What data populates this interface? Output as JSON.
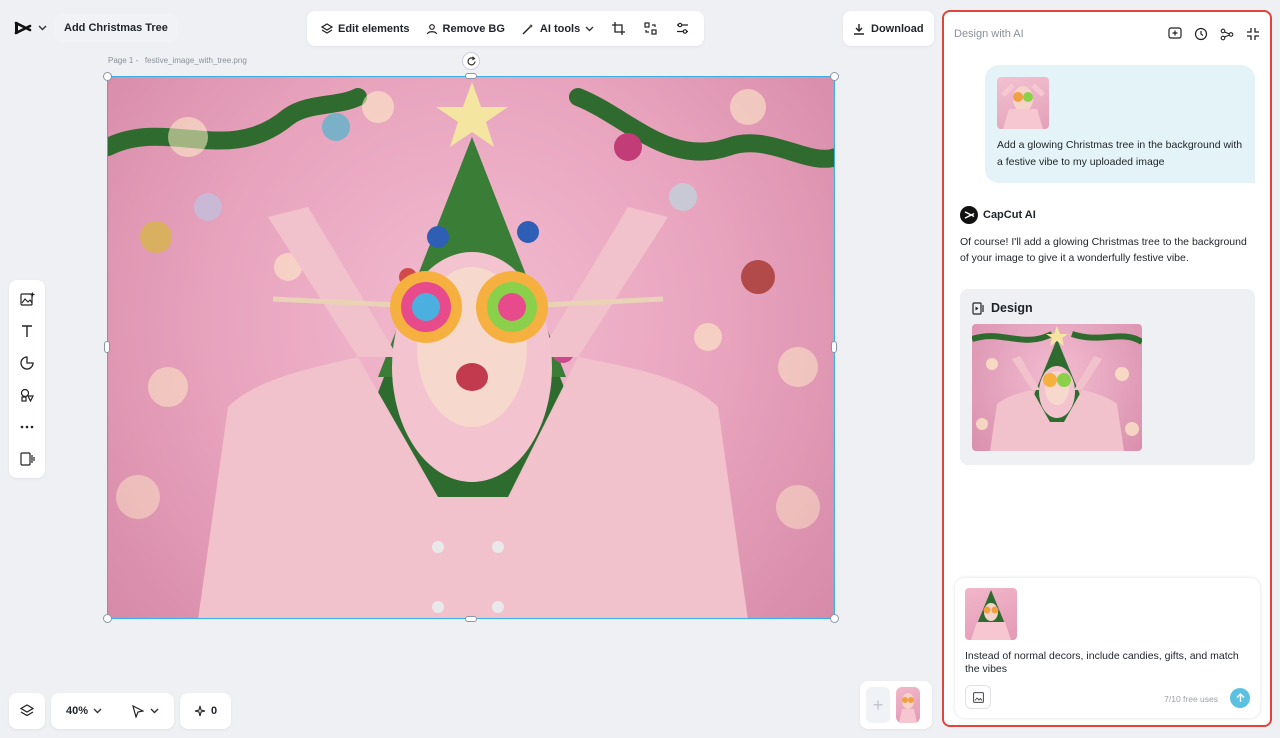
{
  "header": {
    "title": "Add Christmas Tree",
    "download_label": "Download"
  },
  "toolbar": {
    "edit_elements": "Edit elements",
    "remove_bg": "Remove BG",
    "ai_tools": "AI tools"
  },
  "canvas": {
    "page_label": "Page 1 -",
    "file_name": "festive_image_with_tree.png"
  },
  "bottom_bar": {
    "zoom": "40%",
    "credits": "0"
  },
  "ai_panel": {
    "title": "Design with AI",
    "user_message": "Add a glowing Christmas tree in the background with a festive vibe to my uploaded image",
    "ai_name": "CapCut AI",
    "ai_reply": "Of course! I'll add a glowing Christmas tree to the background of your image to give it a wonderfully festive vibe.",
    "design_label": "Design",
    "input_text": "Instead of normal decors, include candies, gifts, and match the vibes",
    "free_uses": "7/10 free uses"
  },
  "colors": {
    "accent": "#3ab0e6",
    "panel_border": "#e0453d",
    "send_button": "#5cc0e0",
    "user_bubble": "#e3f3f7"
  }
}
